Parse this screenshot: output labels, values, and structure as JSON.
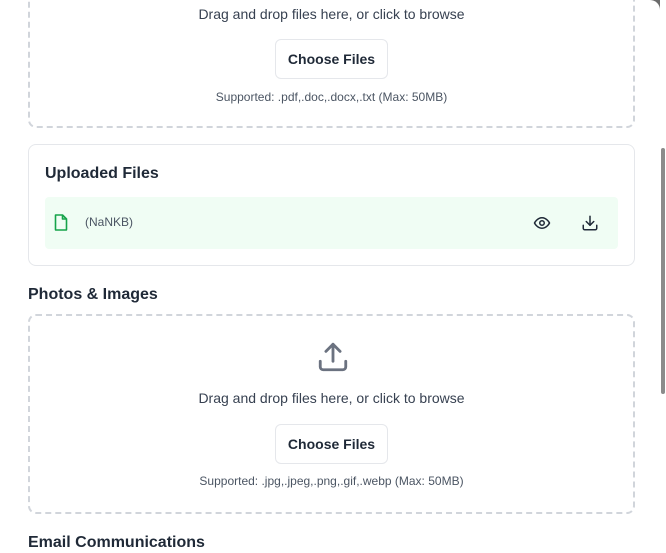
{
  "documents_dropzone": {
    "instruction": "Drag and drop files here, or click to browse",
    "button_label": "Choose Files",
    "supported": "Supported: .pdf,.doc,.docx,.txt (Max: 50MB)"
  },
  "uploaded_files": {
    "title": "Uploaded Files",
    "files": [
      {
        "name": "",
        "size": "(NaNKB)",
        "icon": "file-icon",
        "actions": [
          "eye-icon",
          "download-icon"
        ]
      }
    ],
    "row_bg": "#f0fdf4",
    "icon_color": "#16a34a"
  },
  "photos_section": {
    "title": "Photos & Images",
    "icon": "upload-icon",
    "instruction": "Drag and drop files here, or click to browse",
    "button_label": "Choose Files",
    "supported": "Supported: .jpg,.jpeg,.png,.gif,.webp (Max: 50MB)"
  },
  "email_section": {
    "title": "Email Communications"
  }
}
